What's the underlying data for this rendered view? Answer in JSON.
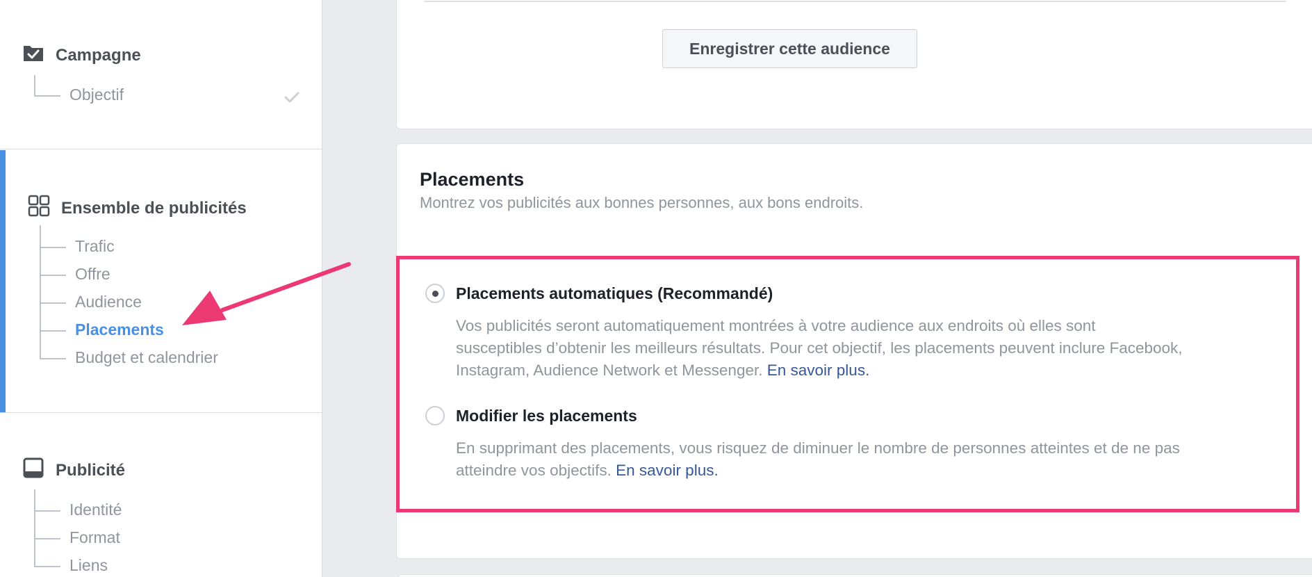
{
  "sidebar": {
    "campaign": {
      "title": "Campagne",
      "icon": "folder-check-icon",
      "items": [
        {
          "label": "Objectif",
          "completed": true
        }
      ]
    },
    "ad_set": {
      "title": "Ensemble de publicités",
      "icon": "grid-icon",
      "items": [
        {
          "label": "Trafic"
        },
        {
          "label": "Offre"
        },
        {
          "label": "Audience"
        },
        {
          "label": "Placements",
          "active": true
        },
        {
          "label": "Budget et calendrier"
        }
      ]
    },
    "ad": {
      "title": "Publicité",
      "icon": "device-icon",
      "items": [
        {
          "label": "Identité"
        },
        {
          "label": "Format"
        },
        {
          "label": "Liens"
        }
      ]
    }
  },
  "audience_card": {
    "save_button_label": "Enregistrer cette audience"
  },
  "placements": {
    "title": "Placements",
    "subtitle": "Montrez vos publicités aux bonnes personnes, aux bons endroits.",
    "options": [
      {
        "title": "Placements automatiques (Recommandé)",
        "selected": true,
        "description_lines": [
          "Vos publicités seront automatiquement montrées à votre audience aux endroits où elles sont",
          "susceptibles d’obtenir les meilleurs résultats. Pour cet objectif, les placements peuvent inclure Facebook,",
          "Instagram, Audience Network et Messenger."
        ],
        "link": "En savoir plus."
      },
      {
        "title": "Modifier les placements",
        "selected": false,
        "description_lines": [
          "En supprimant des placements, vous risquez de diminuer le nombre de personnes atteintes et de ne pas",
          "atteindre vos objectifs."
        ],
        "link": "En savoir plus."
      }
    ]
  },
  "colors": {
    "accent_blue": "#4a90e2",
    "highlight_pink": "#ec3973",
    "link_blue": "#365899"
  }
}
